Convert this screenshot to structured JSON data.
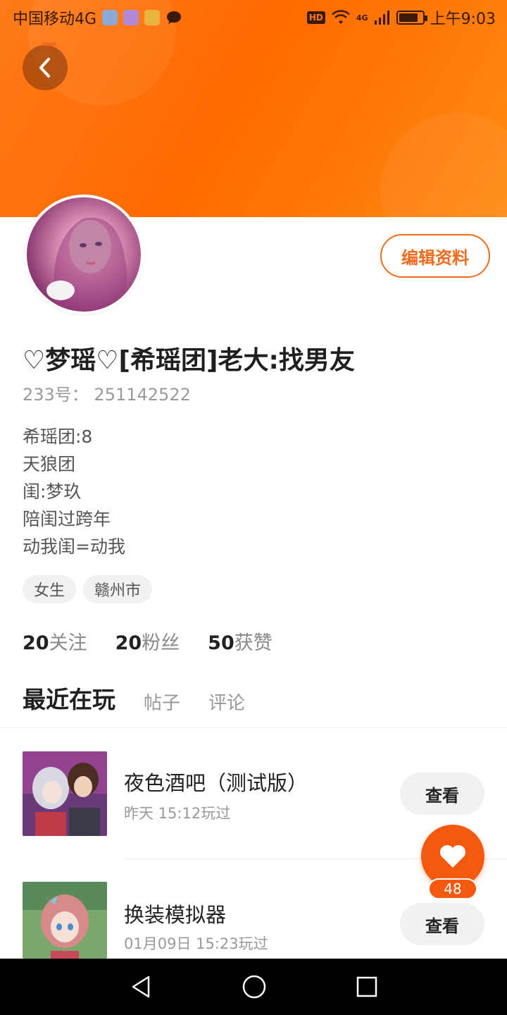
{
  "status_bar": {
    "carrier": "中国移动4G",
    "hd": "HD",
    "network": "4G",
    "time": "上午9:03"
  },
  "profile": {
    "nickname": "♡梦瑶♡[希瑶团]老大:找男友",
    "uid": "233号： 251142522",
    "bio": [
      "希瑶团:8",
      "天狼团",
      "闺:梦玖",
      "陪闺过跨年",
      "动我闺=动我"
    ],
    "tags": [
      "女生",
      "赣州市"
    ],
    "edit_label": "编辑资料"
  },
  "stats": [
    {
      "num": "20",
      "label": "关注"
    },
    {
      "num": "20",
      "label": "粉丝"
    },
    {
      "num": "50",
      "label": "获赞"
    }
  ],
  "tabs": [
    {
      "label": "最近在玩",
      "active": true
    },
    {
      "label": "帖子",
      "active": false
    },
    {
      "label": "评论",
      "active": false
    }
  ],
  "games": [
    {
      "title": "夜色酒吧（测试版）",
      "time": "昨天 15:12玩过",
      "button": "查看"
    },
    {
      "title": "换装模拟器",
      "time": "01月09日 15:23玩过",
      "button": "查看"
    }
  ],
  "like": {
    "count": "48"
  },
  "colors": {
    "accent": "#f06a1d",
    "header": "#ff7a1a",
    "like": "#f5580f"
  },
  "icons": {
    "back": "chevron-left-icon",
    "like": "heart-icon",
    "nav_back": "triangle-back-icon",
    "nav_home": "circle-home-icon",
    "nav_recent": "square-recent-icon"
  }
}
